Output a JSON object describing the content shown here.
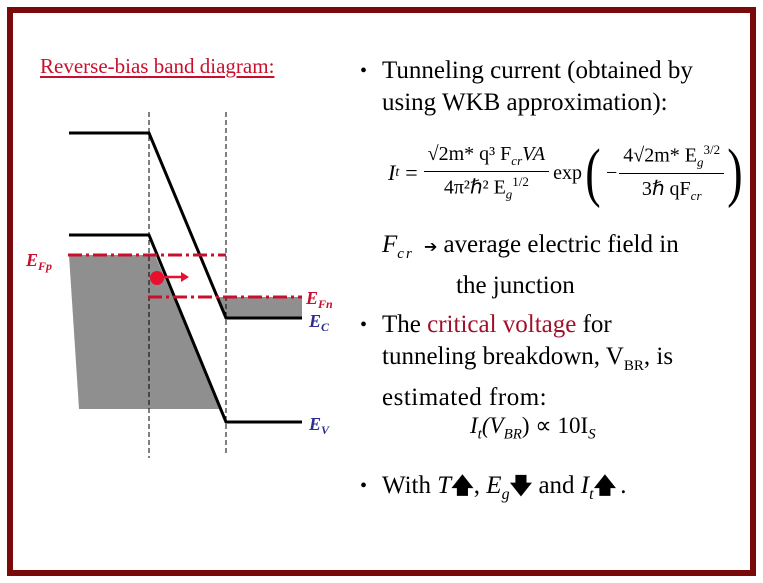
{
  "slide": {
    "border_color": "#7a0a0a",
    "accent_red": "#c8102e",
    "label_blue": "#2e2e8f"
  },
  "diagram": {
    "title": "Reverse-bias band diagram:",
    "labels": {
      "efp_main": "E",
      "efp_sub": "Fp",
      "efn_main": "E",
      "efn_sub": "Fn",
      "ec_main": "E",
      "ec_sub": "C",
      "ev_main": "E",
      "ev_sub": "V"
    },
    "icons": [
      "electron-dot-icon",
      "tunneling-arrow-icon"
    ]
  },
  "bullets": [
    {
      "lines": [
        "Tunneling current (obtained by",
        "using WKB approximation):"
      ]
    },
    {
      "lines": [
        "The ",
        "critical voltage",
        " for",
        "tunneling breakdown, V",
        "BR",
        ", is",
        "estimated from:"
      ]
    },
    {
      "parts": [
        "With ",
        "T",
        ", ",
        "E",
        "g",
        " and ",
        "I",
        "t",
        "."
      ]
    }
  ],
  "equation_tunneling": {
    "lhs": "I",
    "lhs_sub": "t",
    "equals": "=",
    "num": "√2m* q³ F",
    "num_sub": "cr",
    "num_tail": "VA",
    "den": "4π²ℏ² E",
    "den_sub": "g",
    "den_sup": "1/2",
    "exp": "exp",
    "minus": "−",
    "exp_num": "4√2m* E",
    "exp_num_sub": "g",
    "exp_num_sup": "3/2",
    "exp_den": "3ℏ qF",
    "exp_den_sub": "cr"
  },
  "fcr_note": {
    "symbol": "F",
    "symbol_sub": "cr",
    "arrow": "➔",
    "lines": [
      "average electric field in",
      "the junction"
    ]
  },
  "equation_breakdown": {
    "text": "I",
    "sub_t": "t",
    "open": "(V",
    "sub_br": "BR",
    "close": ") ∝ 10I",
    "sub_s": "S"
  },
  "arrows": {
    "up": "🡅",
    "down": "🡇"
  }
}
